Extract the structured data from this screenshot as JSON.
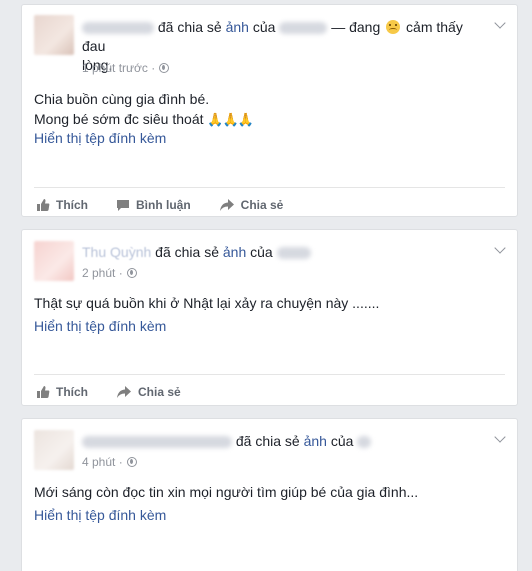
{
  "posts": [
    {
      "share_text_before": "",
      "share_text": "đã chia sẻ",
      "photo_word": "ảnh",
      "of_word": "của",
      "feeling_prefix": "— đang",
      "feeling_text": "cảm thấy đau",
      "feeling_text_2": "lòng.",
      "time": "1 phút trước ·",
      "body_lines": [
        "Chia buồn cùng gia đình bé.",
        "Mong bé sớm đc siêu thoát"
      ],
      "pray_emoji": "🙏🙏🙏",
      "attachment_link": "Hiển thị tệp đính kèm",
      "actions": {
        "like": "Thích",
        "comment": "Bình luận",
        "share": "Chia sẻ"
      }
    },
    {
      "author": "Thu Quỳnh",
      "share_text": "đã chia sẻ",
      "photo_word": "ảnh",
      "of_word": "của",
      "time": "2 phút ·",
      "body_lines": [
        "Thật sự quá buồn khi ở Nhật lại xảy ra chuyện này ......."
      ],
      "attachment_link": "Hiển thị tệp đính kèm",
      "actions": {
        "like": "Thích",
        "share": "Chia sẻ"
      }
    },
    {
      "share_text": "đã chia sẻ",
      "photo_word": "ảnh",
      "of_word": "của",
      "time": "4 phút ·",
      "body_lines": [
        "Mới sáng còn đọc tin xin mọi người tìm giúp bé của gia đình..."
      ],
      "attachment_link": "Hiển thị tệp đính kèm"
    }
  ],
  "icons": {
    "like": "thumbs-up-icon",
    "comment": "comment-icon",
    "share": "share-arrow-icon",
    "privacy": "globe-icon",
    "menu": "chevron-down-icon"
  },
  "colors": {
    "background": "#e9ebee",
    "link": "#365899",
    "meta": "#90949c",
    "action": "#616770"
  }
}
